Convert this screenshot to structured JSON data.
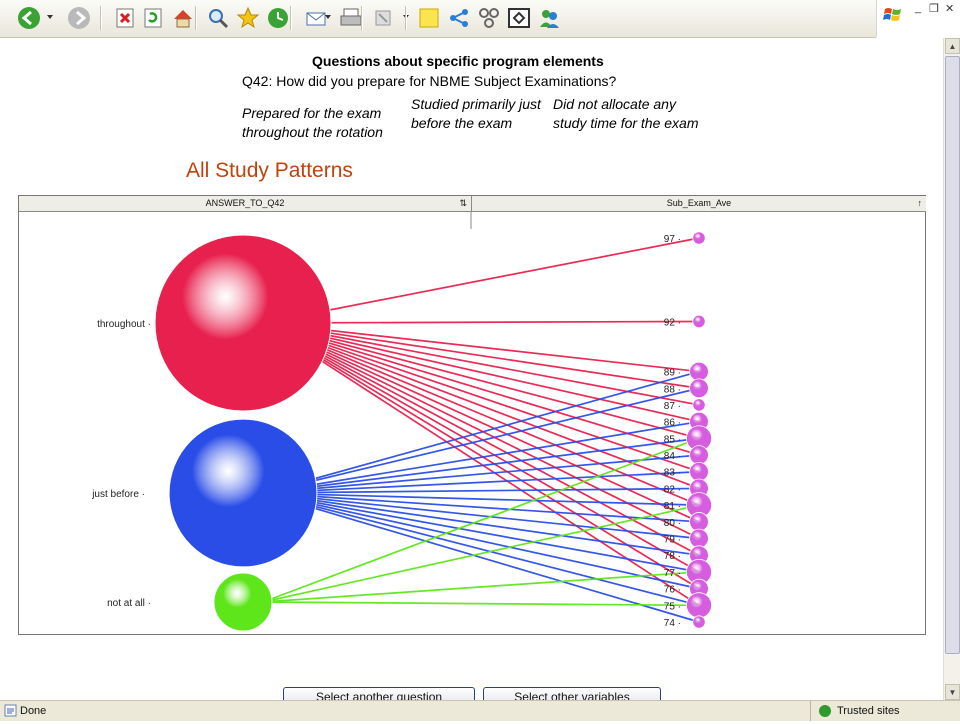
{
  "toolbar": {
    "icons": [
      "back-icon",
      "forward-icon",
      "stop-icon",
      "refresh-icon",
      "home-icon",
      "search-icon",
      "favorites-icon",
      "history-icon",
      "mail-icon",
      "print-icon",
      "edit-icon",
      "note-icon",
      "share-icon",
      "network-icon",
      "frame-icon",
      "messenger-icon"
    ]
  },
  "page": {
    "heading": "Questions about specific program elements",
    "question": "Q42: How did you prepare for NBME Subject Examinations?",
    "options": [
      "Prepared for the exam throughout the rotation",
      "Studied primarily just before the exam",
      "Did not allocate any study time for the exam"
    ],
    "plot_title": "All Study Patterns",
    "buttons": [
      "Select another question",
      "Select other variables"
    ]
  },
  "chart_data": {
    "type": "parallel-sets",
    "columns": [
      "ANSWER_TO_Q42",
      "Sub_Exam_Ave"
    ],
    "left_categories": [
      {
        "label": "throughout",
        "color": "#e8204d",
        "relative_size": 1.0
      },
      {
        "label": "just before",
        "color": "#2a4de8",
        "relative_size": 0.84
      },
      {
        "label": "not at all",
        "color": "#5ee61a",
        "relative_size": 0.33
      }
    ],
    "right_values": [
      97,
      92,
      89,
      88,
      87,
      86,
      85,
      84,
      83,
      82,
      81,
      80,
      79,
      78,
      77,
      76,
      75,
      74
    ],
    "links": [
      {
        "from": "throughout",
        "to": [
          97,
          92,
          89,
          88,
          87,
          86,
          85,
          84,
          83,
          82,
          81,
          80,
          79,
          78,
          77,
          76,
          75
        ]
      },
      {
        "from": "just before",
        "to": [
          89,
          88,
          86,
          85,
          84,
          83,
          82,
          81,
          80,
          79,
          78,
          77,
          76,
          75,
          74
        ]
      },
      {
        "from": "not at all",
        "to": [
          85,
          81,
          77,
          75
        ]
      }
    ],
    "colors": {
      "right_node": "#d65ce0"
    }
  },
  "statusbar": {
    "left": "Done",
    "right": "Trusted sites"
  }
}
